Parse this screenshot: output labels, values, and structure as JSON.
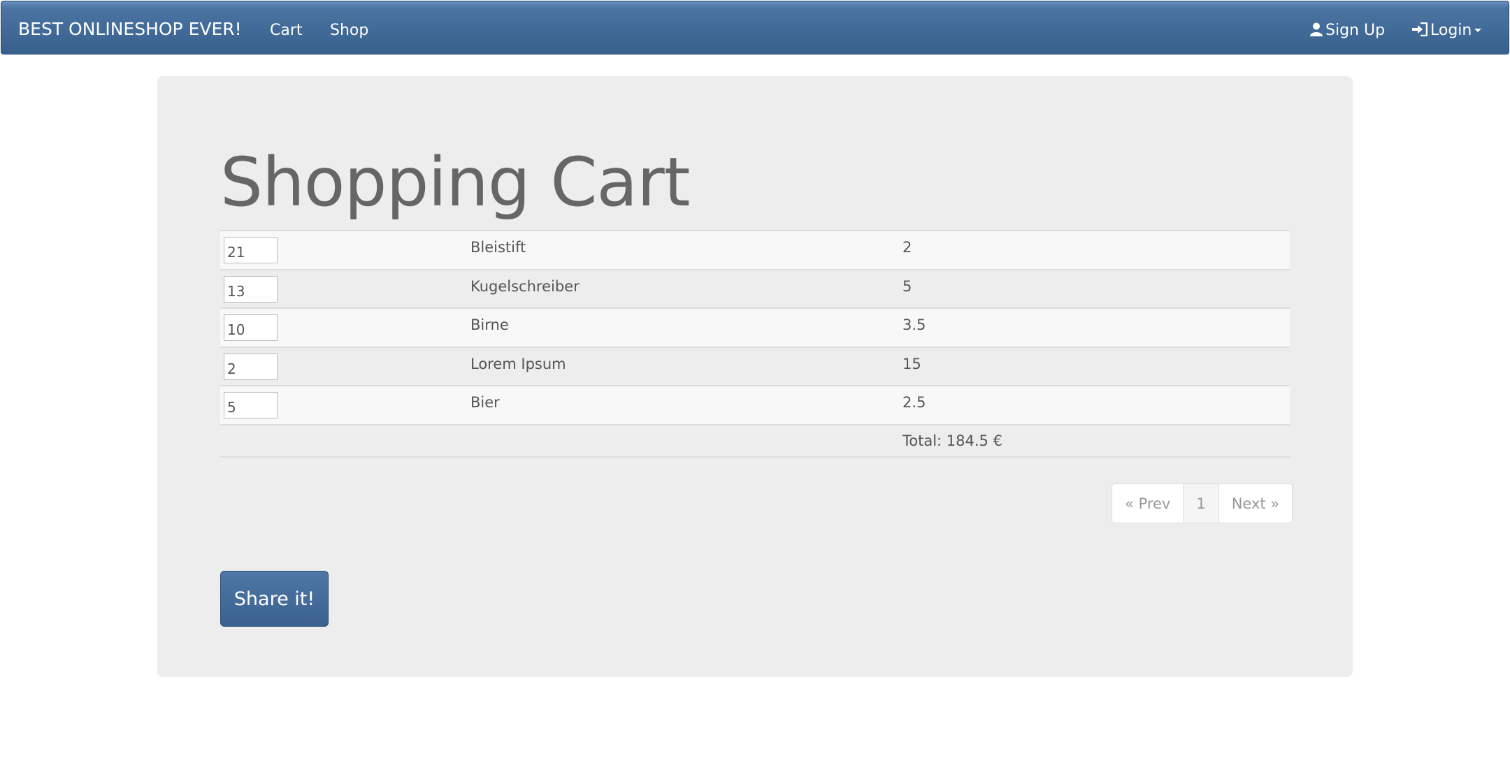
{
  "navbar": {
    "brand": "BEST ONLINESHOP EVER!",
    "links": [
      "Cart",
      "Shop"
    ],
    "signup_label": "Sign Up",
    "login_label": "Login",
    "signup_icon": "user-icon",
    "login_icon": "login-icon"
  },
  "main": {
    "title": "Shopping Cart",
    "cart_items": [
      {
        "quantity": "21",
        "name": "Bleistift",
        "price": "2"
      },
      {
        "quantity": "13",
        "name": "Kugelschreiber",
        "price": "5"
      },
      {
        "quantity": "10",
        "name": "Birne",
        "price": "3.5"
      },
      {
        "quantity": "2",
        "name": "Lorem Ipsum",
        "price": "15"
      },
      {
        "quantity": "5",
        "name": "Bier",
        "price": "2.5"
      }
    ],
    "total": "Total: 184.5 €",
    "pagination": {
      "prev": "« Prev",
      "current": "1",
      "next": "Next »"
    },
    "share_label": "Share it!"
  },
  "colors": {
    "navbar": "#4b74a2",
    "panel": "#ededed",
    "button": "#3f6794"
  }
}
